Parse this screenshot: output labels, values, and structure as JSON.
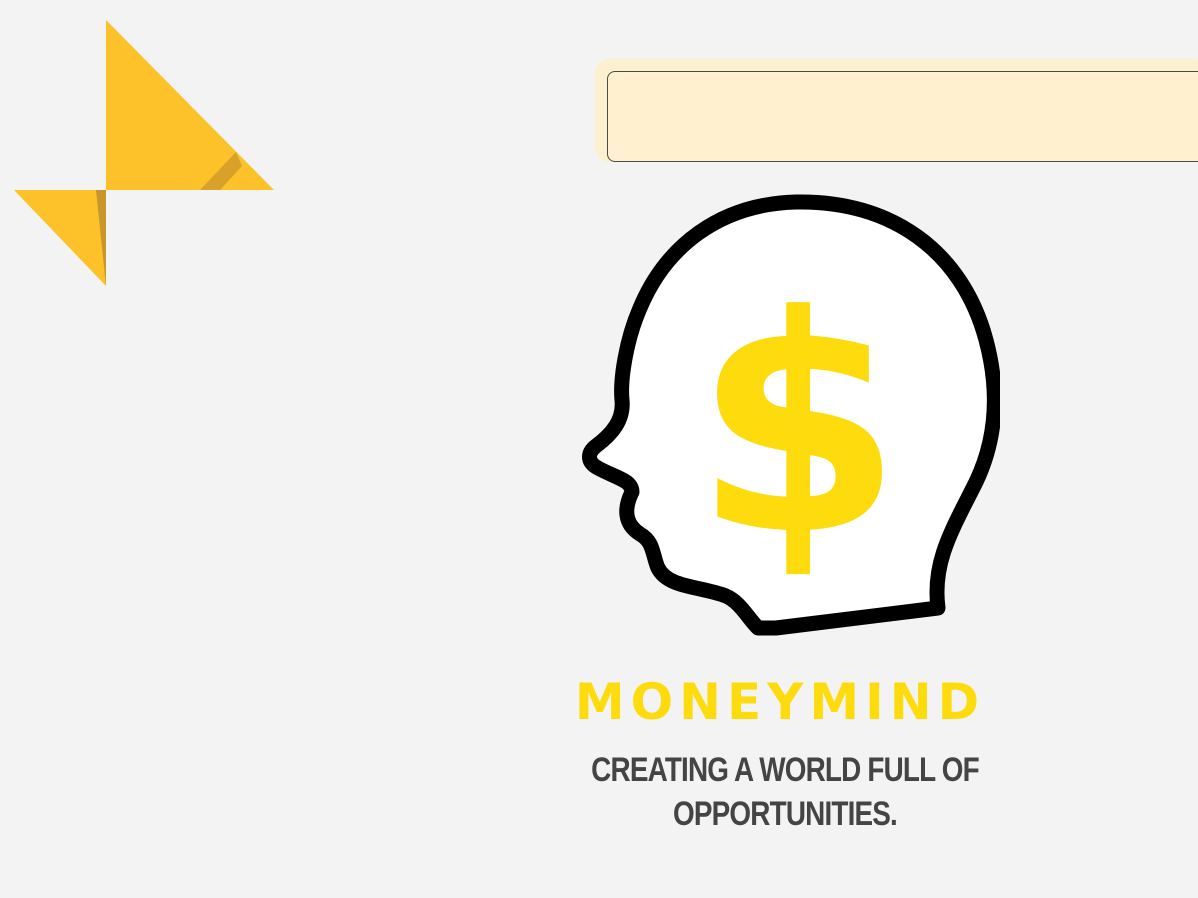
{
  "brand": {
    "name": "MONEYMIND",
    "tagline": "CREATING A WORLD FULL OF OPPORTUNITIES.",
    "logo_symbol": "$"
  },
  "colors": {
    "background": "#f3f3f3",
    "brand_yellow": "#fedb0c",
    "origami_yellow": "#fdc12a",
    "origami_shadow": "#c8962a",
    "banner_fill": "#fff1cf",
    "tagline_gray": "#444444",
    "head_outline": "#000000"
  },
  "icons": {
    "corner_logo": "origami-bird-icon",
    "main_logo": "head-dollar-icon"
  }
}
